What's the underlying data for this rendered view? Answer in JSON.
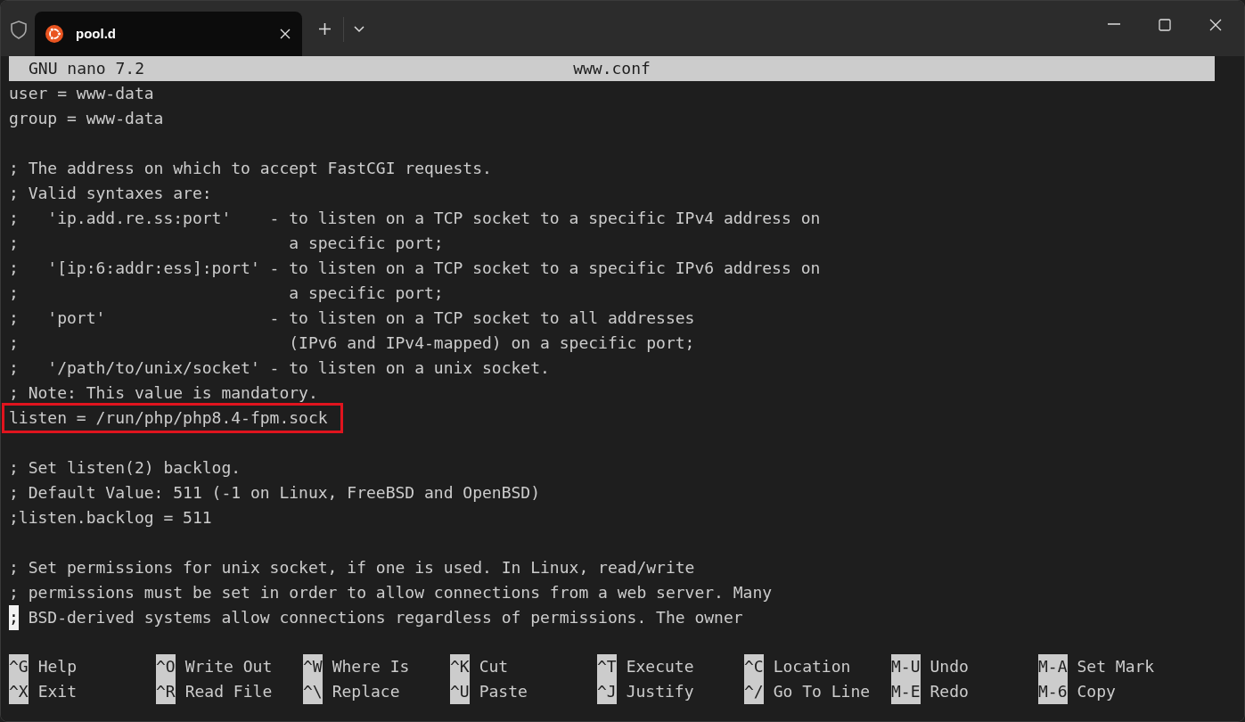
{
  "window": {
    "tab": {
      "title": "pool.d",
      "selected": true
    }
  },
  "nano": {
    "header": {
      "version": "GNU nano 7.2",
      "filename": "www.conf"
    },
    "lines": [
      {
        "kind": "text",
        "text": "user = www-data"
      },
      {
        "kind": "text",
        "text": "group = www-data"
      },
      {
        "kind": "blank"
      },
      {
        "kind": "text",
        "text": "; The address on which to accept FastCGI requests."
      },
      {
        "kind": "text",
        "text": "; Valid syntaxes are:"
      },
      {
        "kind": "text",
        "text": ";   'ip.add.re.ss:port'    - to listen on a TCP socket to a specific IPv4 address on"
      },
      {
        "kind": "text",
        "text": ";                            a specific port;"
      },
      {
        "kind": "text",
        "text": ";   '[ip:6:addr:ess]:port' - to listen on a TCP socket to a specific IPv6 address on"
      },
      {
        "kind": "text",
        "text": ";                            a specific port;"
      },
      {
        "kind": "text",
        "text": ";   'port'                 - to listen on a TCP socket to all addresses"
      },
      {
        "kind": "text",
        "text": ";                            (IPv6 and IPv4-mapped) on a specific port;"
      },
      {
        "kind": "text",
        "text": ";   '/path/to/unix/socket' - to listen on a unix socket."
      },
      {
        "kind": "text",
        "text": "; Note: This value is mandatory."
      },
      {
        "kind": "text",
        "text": "listen = /run/php/php8.4-fpm.sock",
        "highlighted": true
      },
      {
        "kind": "blank"
      },
      {
        "kind": "text",
        "text": "; Set listen(2) backlog."
      },
      {
        "kind": "text",
        "text": "; Default Value: 511 (-1 on Linux, FreeBSD and OpenBSD)"
      },
      {
        "kind": "text",
        "text": ";listen.backlog = 511"
      },
      {
        "kind": "blank"
      },
      {
        "kind": "text",
        "text": "; Set permissions for unix socket, if one is used. In Linux, read/write"
      },
      {
        "kind": "text",
        "text": "; permissions must be set in order to allow connections from a web server. Many"
      },
      {
        "kind": "text",
        "text": "; BSD-derived systems allow connections regardless of permissions. The owner",
        "cursor": true
      }
    ],
    "shortcuts": [
      {
        "key": "^G",
        "label": "Help"
      },
      {
        "key": "^O",
        "label": "Write Out"
      },
      {
        "key": "^W",
        "label": "Where Is"
      },
      {
        "key": "^K",
        "label": "Cut"
      },
      {
        "key": "^T",
        "label": "Execute"
      },
      {
        "key": "^C",
        "label": "Location"
      },
      {
        "key": "M-U",
        "label": "Undo"
      },
      {
        "key": "M-A",
        "label": "Set Mark"
      },
      {
        "key": "^X",
        "label": "Exit"
      },
      {
        "key": "^R",
        "label": "Read File"
      },
      {
        "key": "^\\",
        "label": "Replace"
      },
      {
        "key": "^U",
        "label": "Paste"
      },
      {
        "key": "^J",
        "label": "Justify"
      },
      {
        "key": "^/",
        "label": "Go To Line"
      },
      {
        "key": "M-E",
        "label": "Redo"
      },
      {
        "key": "M-6",
        "label": "Copy"
      }
    ]
  }
}
